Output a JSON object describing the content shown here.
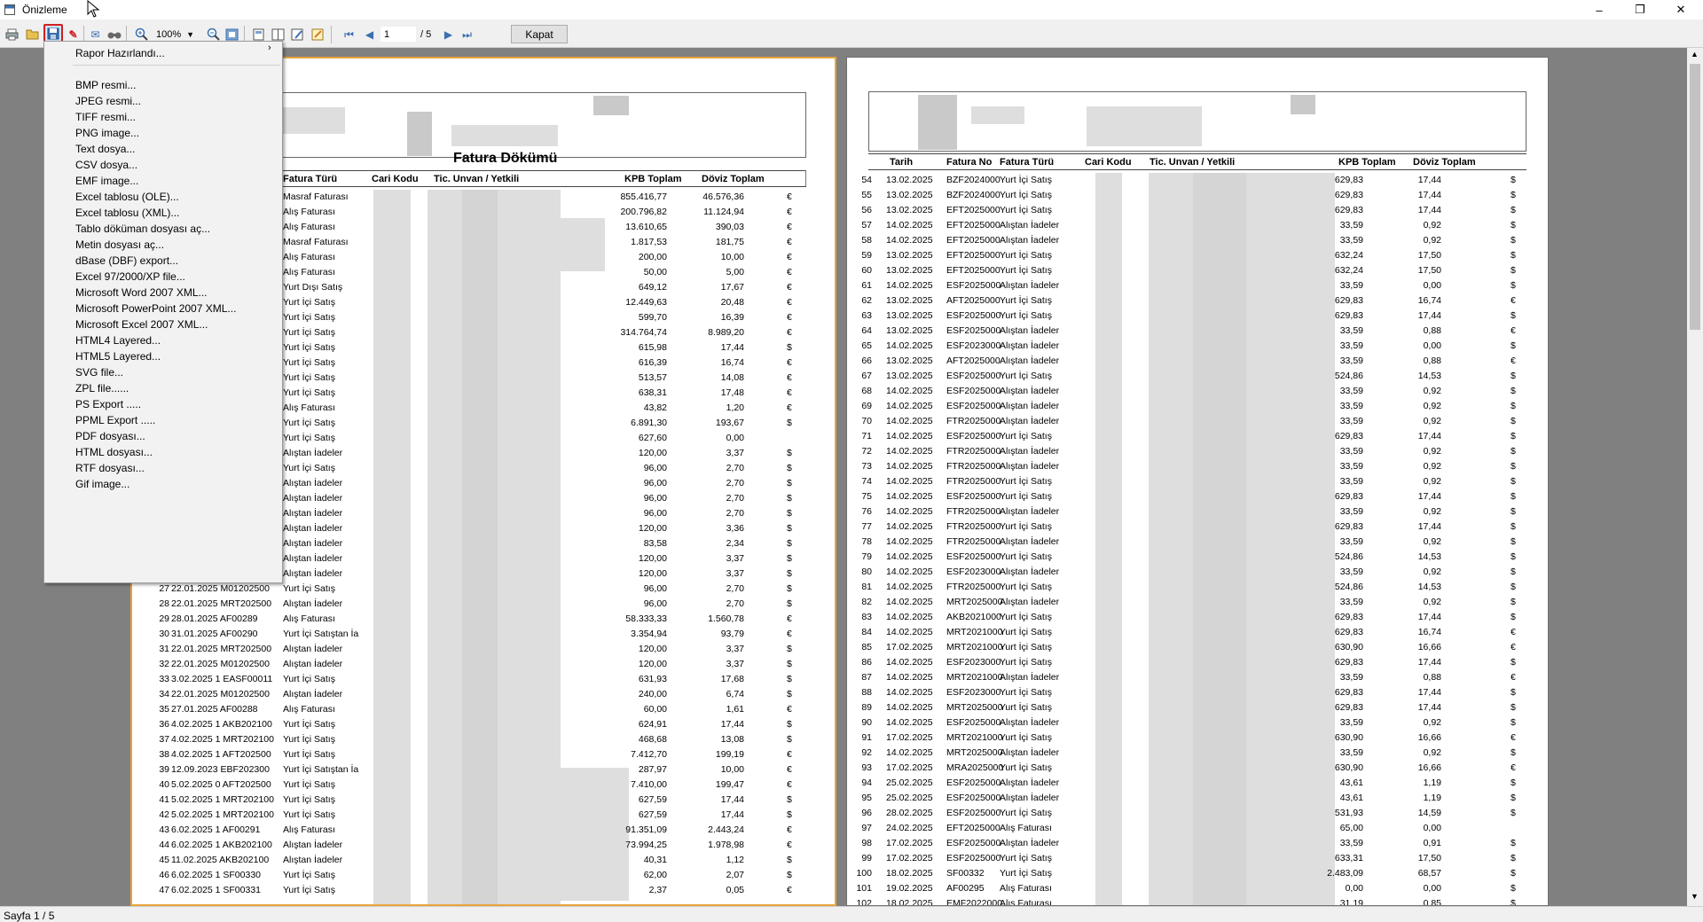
{
  "window": {
    "title": "Önizleme",
    "minimize": "–",
    "restore": "❐",
    "close": "✕"
  },
  "toolbar": {
    "zoom": "100%",
    "page": "1",
    "page_total": "/ 5",
    "close_label": "Kapat",
    "icons": [
      "print-icon",
      "open-folder-icon",
      "save-icon",
      "pdf-icon",
      "email-icon",
      "find-icon",
      "zoom-in-icon",
      "zoom-out-icon",
      "page-setup-icon",
      "single-page-icon",
      "two-page-icon",
      "edit-icon",
      "export-icon",
      "first-page-icon",
      "prev-page-icon",
      "next-page-icon",
      "last-page-icon"
    ]
  },
  "menu": {
    "items": [
      "Rapor Hazırlandı...",
      "BMP resmi...",
      "JPEG resmi...",
      "TIFF resmi...",
      "PNG image...",
      "Text dosya...",
      "CSV dosya...",
      "EMF image...",
      "Excel tablosu (OLE)...",
      "Excel tablosu (XML)...",
      "Tablo döküman dosyası aç...",
      "Metin dosyası aç...",
      "dBase (DBF) export...",
      "Excel 97/2000/XP file...",
      "Microsoft Word 2007 XML...",
      "Microsoft PowerPoint 2007 XML...",
      "Microsoft Excel 2007 XML...",
      "HTML4 Layered...",
      "HTML5 Layered...",
      "SVG file...",
      "ZPL file......",
      "PS Export .....",
      "PPML Export .....",
      "PDF dosyası...",
      "HTML dosyası...",
      "RTF dosyası...",
      "Gif image..."
    ],
    "submenu_arrow": "›"
  },
  "page1": {
    "title": "Fatura Dökümü",
    "headers": [
      "Fatura Türü",
      "Cari Kodu",
      "Tic. Unvan / Yetkili",
      "KPB Toplam",
      "Döviz Toplam"
    ],
    "rows": [
      [
        "",
        "",
        "Masraf Faturası",
        "855.416,77",
        "46.576,36",
        "€"
      ],
      [
        "",
        "",
        "Alış Faturası",
        "200.796,82",
        "11.124,94",
        "€"
      ],
      [
        "",
        "",
        "Alış Faturası",
        "13.610,65",
        "390,03",
        "€"
      ],
      [
        "",
        "",
        "Masraf Faturası",
        "1.817,53",
        "181,75",
        "€"
      ],
      [
        "",
        "",
        "Alış Faturası",
        "200,00",
        "10,00",
        "€"
      ],
      [
        "",
        "",
        "Alış Faturası",
        "50,00",
        "5,00",
        "€"
      ],
      [
        "",
        "",
        "Yurt Dışı Satış",
        "649,12",
        "17,67",
        "€"
      ],
      [
        "",
        "",
        "Yurt İçi Satış",
        "12.449,63",
        "20,48",
        "€"
      ],
      [
        "",
        "",
        "Yurt İçi Satış",
        "599,70",
        "16,39",
        "€"
      ],
      [
        "",
        "",
        "Yurt İçi Satış",
        "314.764,74",
        "8.989,20",
        "€"
      ],
      [
        "",
        "",
        "Yurt İçi Satış",
        "615,98",
        "17,44",
        "$"
      ],
      [
        "",
        "",
        "Yurt İçi Satış",
        "616,39",
        "16,74",
        "€"
      ],
      [
        "",
        "",
        "Yurt İçi Satış",
        "513,57",
        "14,08",
        "€"
      ],
      [
        "",
        "",
        "Yurt İçi Satış",
        "638,31",
        "17,48",
        "€"
      ],
      [
        "",
        "",
        "Alış Faturası",
        "43,82",
        "1,20",
        "€"
      ],
      [
        "",
        "",
        "Yurt İçi Satış",
        "6.891,30",
        "193,67",
        "$"
      ],
      [
        "",
        "",
        "Yurt İçi Satış",
        "627,60",
        "0,00",
        ""
      ],
      [
        "",
        "",
        "Alıştan İadeler",
        "120,00",
        "3,37",
        "$"
      ],
      [
        "",
        "",
        "Yurt İçi Satış",
        "96,00",
        "2,70",
        "$"
      ],
      [
        "",
        "",
        "Alıştan İadeler",
        "96,00",
        "2,70",
        "$"
      ],
      [
        "",
        "",
        "Alıştan İadeler",
        "96,00",
        "2,70",
        "$"
      ],
      [
        "",
        "",
        "Alıştan İadeler",
        "96,00",
        "2,70",
        "$"
      ],
      [
        "",
        "",
        "Alıştan İadeler",
        "120,00",
        "3,36",
        "$"
      ],
      [
        "",
        "",
        "Alıştan İadeler",
        "83,58",
        "2,34",
        "$"
      ],
      [
        "",
        "",
        "Alıştan İadeler",
        "120,00",
        "3,37",
        "$"
      ],
      [
        "",
        "",
        "Alıştan İadeler",
        "120,00",
        "3,37",
        "$"
      ],
      [
        "27",
        "22.01.2025 M01202500",
        "Yurt İçi Satış",
        "96,00",
        "2,70",
        "$"
      ],
      [
        "28",
        "22.01.2025 MRT202500",
        "Alıştan İadeler",
        "96,00",
        "2,70",
        "$"
      ],
      [
        "29",
        "28.01.2025 AF00289",
        "Alış Faturası",
        "58.333,33",
        "1.560,78",
        "€"
      ],
      [
        "30",
        "31.01.2025 AF00290",
        "Yurt İçi Satıştan İa",
        "3.354,94",
        "93,79",
        "€"
      ],
      [
        "31",
        "22.01.2025 MRT202500",
        "Alıştan İadeler",
        "120,00",
        "3,37",
        "$"
      ],
      [
        "32",
        "22.01.2025 M01202500",
        "Alıştan İadeler",
        "120,00",
        "3,37",
        "$"
      ],
      [
        "33",
        "3.02.2025 1 EASF00011",
        "Yurt İçi Satış",
        "631,93",
        "17,68",
        "$"
      ],
      [
        "34",
        "22.01.2025 M01202500",
        "Alıştan İadeler",
        "240,00",
        "6,74",
        "$"
      ],
      [
        "35",
        "27.01.2025 AF00288",
        "Alış Faturası",
        "60,00",
        "1,61",
        "€"
      ],
      [
        "36",
        "4.02.2025 1 AKB202100",
        "Yurt İçi Satış",
        "624,91",
        "17,44",
        "$"
      ],
      [
        "37",
        "4.02.2025 1 MRT202100",
        "Yurt İçi Satış",
        "468,68",
        "13,08",
        "$"
      ],
      [
        "38",
        "4.02.2025 1 AFT202500",
        "Yurt İçi Satış",
        "7.412,70",
        "199,19",
        "€"
      ],
      [
        "39",
        "12.09.2023 EBF202300",
        "Yurt İçi Satıştan İa",
        "287,97",
        "10,00",
        "€"
      ],
      [
        "40",
        "5.02.2025 0 AFT202500",
        "Yurt İçi Satış",
        "7.410,00",
        "199,47",
        "€"
      ],
      [
        "41",
        "5.02.2025 1 MRT202100",
        "Yurt İçi Satış",
        "627,59",
        "17,44",
        "$"
      ],
      [
        "42",
        "5.02.2025 1 MRT202100",
        "Yurt İçi Satış",
        "627,59",
        "17,44",
        "$"
      ],
      [
        "43",
        "6.02.2025 1 AF00291",
        "Alış Faturası",
        "91.351,09",
        "2.443,24",
        "€"
      ],
      [
        "44",
        "6.02.2025 1 AKB202100",
        "Alıştan İadeler",
        "73.994,25",
        "1.978,98",
        "€"
      ],
      [
        "45",
        "11.02.2025 AKB202100",
        "Alıştan İadeler",
        "40,31",
        "1,12",
        "$"
      ],
      [
        "46",
        "6.02.2025 1 SF00330",
        "Yurt İçi Satış",
        "62,00",
        "2,07",
        "$"
      ],
      [
        "47",
        "6.02.2025 1 SF00331",
        "Yurt İçi Satış",
        "2,37",
        "0,05",
        "€"
      ]
    ]
  },
  "page2": {
    "headers": [
      "Tarih",
      "Fatura No",
      "Fatura Türü",
      "Cari Kodu",
      "Tic. Unvan / Yetkili",
      "KPB Toplam",
      "Döviz Toplam"
    ],
    "rows": [
      [
        "54",
        "13.02.2025",
        "BZF2024000",
        "Yurt İçi Satış",
        "629,83",
        "17,44",
        "$"
      ],
      [
        "55",
        "13.02.2025",
        "BZF2024000",
        "Yurt İçi Satış",
        "629,83",
        "17,44",
        "$"
      ],
      [
        "56",
        "13.02.2025",
        "EFT2025000",
        "Yurt İçi Satış",
        "629,83",
        "17,44",
        "$"
      ],
      [
        "57",
        "14.02.2025",
        "EFT2025000",
        "Alıştan İadeler",
        "33,59",
        "0,92",
        "$"
      ],
      [
        "58",
        "14.02.2025",
        "EFT2025000",
        "Alıştan İadeler",
        "33,59",
        "0,92",
        "$"
      ],
      [
        "59",
        "13.02.2025",
        "EFT2025000",
        "Yurt İçi Satış",
        "632,24",
        "17,50",
        "$"
      ],
      [
        "60",
        "13.02.2025",
        "EFT2025000",
        "Yurt İçi Satış",
        "632,24",
        "17,50",
        "$"
      ],
      [
        "61",
        "14.02.2025",
        "ESF2025000",
        "Alıştan İadeler",
        "33,59",
        "0,00",
        "$"
      ],
      [
        "62",
        "13.02.2025",
        "AFT2025000",
        "Yurt İçi Satış",
        "629,83",
        "16,74",
        "€"
      ],
      [
        "63",
        "13.02.2025",
        "ESF2025000",
        "Yurt İçi Satış",
        "629,83",
        "17,44",
        "$"
      ],
      [
        "64",
        "13.02.2025",
        "ESF2025000",
        "Alıştan İadeler",
        "33,59",
        "0,88",
        "€"
      ],
      [
        "65",
        "14.02.2025",
        "ESF2023000",
        "Alıştan İadeler",
        "33,59",
        "0,00",
        "$"
      ],
      [
        "66",
        "13.02.2025",
        "AFT2025000",
        "Alıştan İadeler",
        "33,59",
        "0,88",
        "€"
      ],
      [
        "67",
        "13.02.2025",
        "ESF2025000",
        "Yurt İçi Satış",
        "524,86",
        "14,53",
        "$"
      ],
      [
        "68",
        "14.02.2025",
        "ESF2025000",
        "Alıştan İadeler",
        "33,59",
        "0,92",
        "$"
      ],
      [
        "69",
        "14.02.2025",
        "ESF2025000",
        "Alıştan İadeler",
        "33,59",
        "0,92",
        "$"
      ],
      [
        "70",
        "14.02.2025",
        "FTR2025000",
        "Alıştan İadeler",
        "33,59",
        "0,92",
        "$"
      ],
      [
        "71",
        "14.02.2025",
        "ESF2025000",
        "Yurt İçi Satış",
        "629,83",
        "17,44",
        "$"
      ],
      [
        "72",
        "14.02.2025",
        "FTR2025000",
        "Alıştan İadeler",
        "33,59",
        "0,92",
        "$"
      ],
      [
        "73",
        "14.02.2025",
        "FTR2025000",
        "Alıştan İadeler",
        "33,59",
        "0,92",
        "$"
      ],
      [
        "74",
        "14.02.2025",
        "FTR2025000",
        "Yurt İçi Satış",
        "33,59",
        "0,92",
        "$"
      ],
      [
        "75",
        "14.02.2025",
        "ESF2025000",
        "Yurt İçi Satış",
        "629,83",
        "17,44",
        "$"
      ],
      [
        "76",
        "14.02.2025",
        "FTR2025000",
        "Alıştan İadeler",
        "33,59",
        "0,92",
        "$"
      ],
      [
        "77",
        "14.02.2025",
        "FTR2025000",
        "Yurt İçi Satış",
        "629,83",
        "17,44",
        "$"
      ],
      [
        "78",
        "14.02.2025",
        "FTR2025000",
        "Alıştan İadeler",
        "33,59",
        "0,92",
        "$"
      ],
      [
        "79",
        "14.02.2025",
        "ESF2025000",
        "Yurt İçi Satış",
        "524,86",
        "14,53",
        "$"
      ],
      [
        "80",
        "14.02.2025",
        "ESF2023000",
        "Alıştan İadeler",
        "33,59",
        "0,92",
        "$"
      ],
      [
        "81",
        "14.02.2025",
        "FTR2025000",
        "Yurt İçi Satış",
        "524,86",
        "14,53",
        "$"
      ],
      [
        "82",
        "14.02.2025",
        "MRT2025000",
        "Alıştan İadeler",
        "33,59",
        "0,92",
        "$"
      ],
      [
        "83",
        "14.02.2025",
        "AKB2021000",
        "Yurt İçi Satış",
        "629,83",
        "17,44",
        "$"
      ],
      [
        "84",
        "14.02.2025",
        "MRT2021000",
        "Yurt İçi Satış",
        "629,83",
        "16,74",
        "€"
      ],
      [
        "85",
        "17.02.2025",
        "MRT2021000",
        "Yurt İçi Satış",
        "630,90",
        "16,66",
        "€"
      ],
      [
        "86",
        "14.02.2025",
        "ESF2023000",
        "Yurt İçi Satış",
        "629,83",
        "17,44",
        "$"
      ],
      [
        "87",
        "14.02.2025",
        "MRT2021000",
        "Alıştan İadeler",
        "33,59",
        "0,88",
        "€"
      ],
      [
        "88",
        "14.02.2025",
        "ESF2023000",
        "Yurt İçi Satış",
        "629,83",
        "17,44",
        "$"
      ],
      [
        "89",
        "14.02.2025",
        "MRT2025000",
        "Yurt İçi Satış",
        "629,83",
        "17,44",
        "$"
      ],
      [
        "90",
        "14.02.2025",
        "ESF2025000",
        "Alıştan İadeler",
        "33,59",
        "0,92",
        "$"
      ],
      [
        "91",
        "17.02.2025",
        "MRT2021000",
        "Yurt İçi Satış",
        "630,90",
        "16,66",
        "€"
      ],
      [
        "92",
        "14.02.2025",
        "MRT2025000",
        "Alıştan İadeler",
        "33,59",
        "0,92",
        "$"
      ],
      [
        "93",
        "17.02.2025",
        "MRA2025000",
        "Yurt İçi Satış",
        "630,90",
        "16,66",
        "€"
      ],
      [
        "94",
        "25.02.2025",
        "ESF2025000",
        "Alıştan İadeler",
        "43,61",
        "1,19",
        "$"
      ],
      [
        "95",
        "25.02.2025",
        "ESF2025000",
        "Alıştan İadeler",
        "43,61",
        "1,19",
        "$"
      ],
      [
        "96",
        "28.02.2025",
        "ESF2025000",
        "Yurt İçi Satış",
        "531,93",
        "14,59",
        "$"
      ],
      [
        "97",
        "24.02.2025",
        "EFT2025000",
        "Alış Faturası",
        "65,00",
        "0,00",
        ""
      ],
      [
        "98",
        "17.02.2025",
        "ESF2025000",
        "Alıştan İadeler",
        "33,59",
        "0,91",
        "$"
      ],
      [
        "99",
        "17.02.2025",
        "ESF2025000",
        "Yurt İçi Satış",
        "633,31",
        "17,50",
        "$"
      ],
      [
        "100",
        "18.02.2025",
        "SF00332",
        "Yurt İçi Satış",
        "2.483,09",
        "68,57",
        "$"
      ],
      [
        "101",
        "19.02.2025",
        "AF00295",
        "Alış Faturası",
        "0,00",
        "0,00",
        "$"
      ],
      [
        "102",
        "18.02.2025",
        "EMF2022000",
        "Alış Faturası",
        "31,19",
        "0,85",
        "$"
      ]
    ]
  },
  "status": {
    "text": "Sayfa 1 / 5"
  }
}
